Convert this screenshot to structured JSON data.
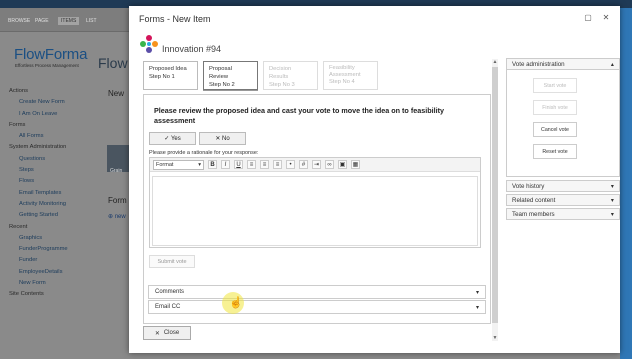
{
  "background": {
    "ribbon_tabs": [
      "BROWSE",
      "PAGE",
      "ITEMS",
      "LIST"
    ],
    "brand": {
      "flow": "Flow",
      "forma": "Forma",
      "tagline": "Effortless Process Management"
    },
    "page_title_fragment": "Flow",
    "new_fragment": "New",
    "grain_label": "Grain",
    "form_fragment": "Form",
    "new_link": "new",
    "nav": [
      {
        "label": "Actions",
        "sub": false
      },
      {
        "label": "Create New Form",
        "sub": true
      },
      {
        "label": "I Am On Leave",
        "sub": true
      },
      {
        "label": "Forms",
        "sub": false
      },
      {
        "label": "All Forms",
        "sub": true
      },
      {
        "label": "System Administration",
        "sub": false
      },
      {
        "label": "Questions",
        "sub": true
      },
      {
        "label": "Steps",
        "sub": true
      },
      {
        "label": "Flows",
        "sub": true
      },
      {
        "label": "Email Templates",
        "sub": true
      },
      {
        "label": "Activity Monitoring",
        "sub": true
      },
      {
        "label": "Getting Started",
        "sub": true
      },
      {
        "label": "Recent",
        "sub": false
      },
      {
        "label": "Graphics",
        "sub": true
      },
      {
        "label": "FunderProgramme",
        "sub": true
      },
      {
        "label": "Funder",
        "sub": true
      },
      {
        "label": "EmployeeDetails",
        "sub": true
      },
      {
        "label": "New Form",
        "sub": true
      },
      {
        "label": "Site Contents",
        "sub": false
      }
    ]
  },
  "dialog": {
    "title": "Forms - New Item",
    "form_name": "Innovation #94",
    "steps": [
      {
        "line1": "Proposed Idea",
        "line2": "Step No 1",
        "state": "normal"
      },
      {
        "line1": "Proposal Review",
        "line2": "Step No 2",
        "state": "active"
      },
      {
        "line1": "Decision Results",
        "line2": "Step No 3",
        "state": "disabled"
      },
      {
        "line1": "Feasibility Assessment",
        "line2": "Step No 4",
        "state": "disabled"
      }
    ],
    "instruction": "Please review the proposed idea and  cast your vote to move the idea on to feasibility assessment",
    "vote_yes": "Yes",
    "vote_no": "No",
    "rationale_label": "Please provide a rationale for your response:",
    "format_select": "Format",
    "submit_vote": "Submit vote",
    "sections": {
      "comments": "Comments",
      "email_cc": "Email CC"
    },
    "close_label": "Close"
  },
  "right_panel": {
    "vote_admin_title": "Vote administration",
    "buttons": [
      {
        "label": "Start vote",
        "enabled": false
      },
      {
        "label": "Finish vote",
        "enabled": false
      },
      {
        "label": "Cancel vote",
        "enabled": true
      },
      {
        "label": "Reset vote",
        "enabled": true
      }
    ],
    "collapsed": [
      "Vote history",
      "Related content",
      "Team members"
    ]
  }
}
